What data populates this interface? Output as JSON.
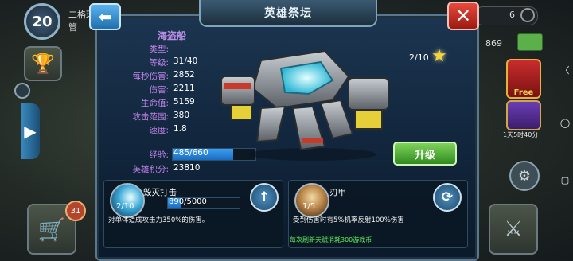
{
  "background": {
    "player_level": "20",
    "player_name": "二格玛",
    "player_sub": "管",
    "counter_top": "6",
    "currency_value": "869",
    "free_label": "Free",
    "timer_text": "1天5时40分",
    "cart_badge": "31",
    "nav_back": "〈",
    "nav_home": "◯",
    "nav_recent": "▢"
  },
  "window": {
    "title": "英雄祭坛",
    "back_icon": "arrow-left-icon",
    "close_icon": "close-icon"
  },
  "hero": {
    "name": "海盗船",
    "stats": [
      {
        "label": "类型:",
        "value": ""
      },
      {
        "label": "等级:",
        "value": "31/40"
      },
      {
        "label": "每秒伤害:",
        "value": "2852"
      },
      {
        "label": "伤害:",
        "value": "2211"
      },
      {
        "label": "生命值:",
        "value": "5159"
      },
      {
        "label": "攻击范围:",
        "value": "380"
      },
      {
        "label": "速度:",
        "value": "1.8"
      },
      {
        "label": "经验:",
        "value": "485/660"
      },
      {
        "label": "英雄积分:",
        "value": "23810"
      }
    ],
    "exp_fraction": 0.735,
    "stars": "2/10",
    "upgrade_label": "升级"
  },
  "skills": [
    {
      "name": "毁灭打击",
      "level": "2/10",
      "progress_text": "890/5000",
      "progress_fraction": 0.178,
      "description": "对单体造成攻击力350%的伤害。",
      "button_icon": "arrow-up-icon"
    },
    {
      "name": "刃甲",
      "level": "1/5",
      "description": "受到伤害时有5%机率反射100%伤害",
      "button_icon": "refresh-icon",
      "note": "每次刷新天赋消耗300游戏币"
    }
  ],
  "colors": {
    "stat_label": "#c083ea",
    "hero_name": "#b88de6",
    "refresh_note": "#5ef05e",
    "star": "#f5d33a"
  }
}
